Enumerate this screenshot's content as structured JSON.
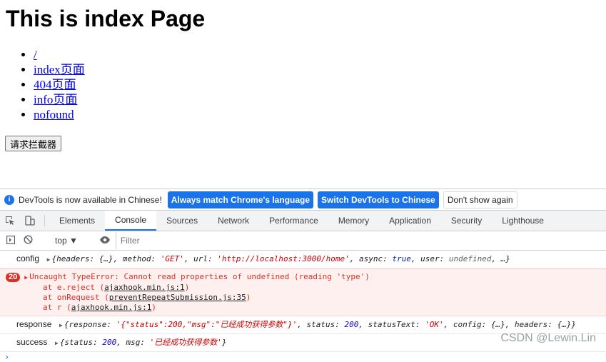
{
  "page": {
    "title": "This is index Page",
    "links": [
      "/",
      "index页面",
      "404页面",
      "info页面",
      "nofound"
    ],
    "button_label": "请求拦截器"
  },
  "devtools": {
    "info_text": "DevTools is now available in Chinese!",
    "btn_match": "Always match Chrome's language",
    "btn_switch": "Switch DevTools to Chinese",
    "btn_dismiss": "Don't show again",
    "tabs": [
      "Elements",
      "Console",
      "Sources",
      "Network",
      "Performance",
      "Memory",
      "Application",
      "Security",
      "Lighthouse"
    ],
    "active_tab": "Console",
    "context": "top",
    "filter_placeholder": "Filter",
    "log_config": {
      "label": "config",
      "parts": [
        "{headers: {…}, method: ",
        "'GET'",
        ", url: ",
        "'http://localhost:3000/home'",
        ", async: ",
        "true",
        ", user: ",
        "undefined",
        ", …}"
      ]
    },
    "error": {
      "count": "20",
      "message": "Uncaught TypeError: Cannot read properties of undefined (reading 'type')",
      "stack": [
        {
          "fn": "at e.reject (",
          "file": "ajaxhook.min.js:1",
          "end": ")"
        },
        {
          "fn": "at onRequest (",
          "file": "preventRepeatSubmission.js:35",
          "end": ")"
        },
        {
          "fn": "at r (",
          "file": "ajaxhook.min.js:1",
          "end": ")"
        }
      ]
    },
    "log_response": {
      "label": "response",
      "parts": [
        "{response: ",
        "'{\"status\":200,\"msg\":\"已经成功获得参数\"}'",
        ", status: ",
        "200",
        ", statusText: ",
        "'OK'",
        ", config: {…}, headers: {…}}"
      ]
    },
    "log_success": {
      "label": "success",
      "parts": [
        "{status: ",
        "200",
        ", msg: ",
        "'已经成功获得参数'",
        "}"
      ]
    },
    "prompt": "›"
  },
  "watermark": "CSDN @Lewin.Lin"
}
